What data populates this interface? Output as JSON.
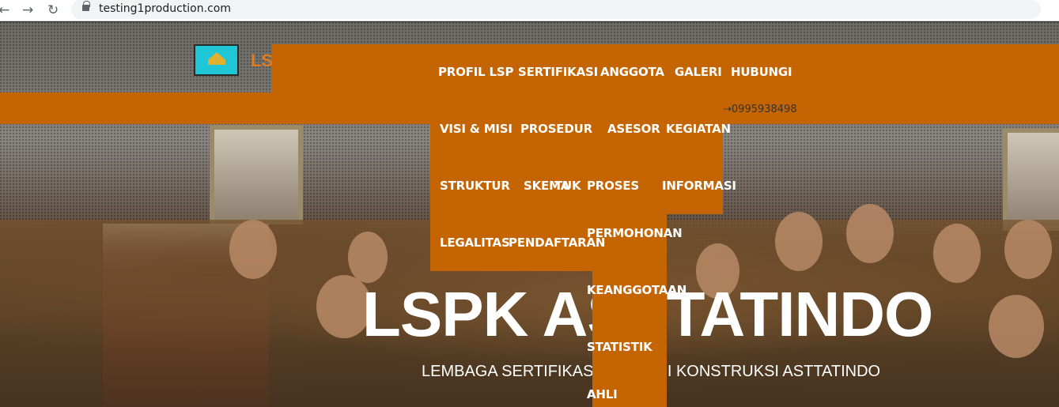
{
  "browser": {
    "back_icon": "←",
    "forward_icon": "→",
    "reload_icon": "↻",
    "url": "testing1production.com"
  },
  "site": {
    "logo_text": "LS",
    "phone": "0995938498",
    "accent_color": "#c46403"
  },
  "nav": {
    "top": [
      "PROFIL LSP",
      "SERTIFIKASI",
      "ANGGOTA",
      "GALERI",
      "HUBUNGI"
    ],
    "profil_lsp": [
      "VISI & MISI",
      "STRUKTUR",
      "LEGALITAS"
    ],
    "sertifikasi": [
      "PROSEDUR",
      "SKEMA",
      "PENDAFTARAN"
    ],
    "anggota": [
      "ASESOR",
      "TUK"
    ],
    "anggota_proses": [
      "PROSES",
      "PERMOHONAN",
      "KEANGGOTAAN",
      "STATISTIK",
      "AHLI"
    ],
    "galeri": [
      "KEGIATAN",
      "INFORMASI"
    ]
  },
  "hero": {
    "title": "LSPK ASTTATINDO",
    "subtitle": "LEMBAGA SERTIFIKASI PROFESI KONSTRUKSI ASTTATINDO"
  }
}
